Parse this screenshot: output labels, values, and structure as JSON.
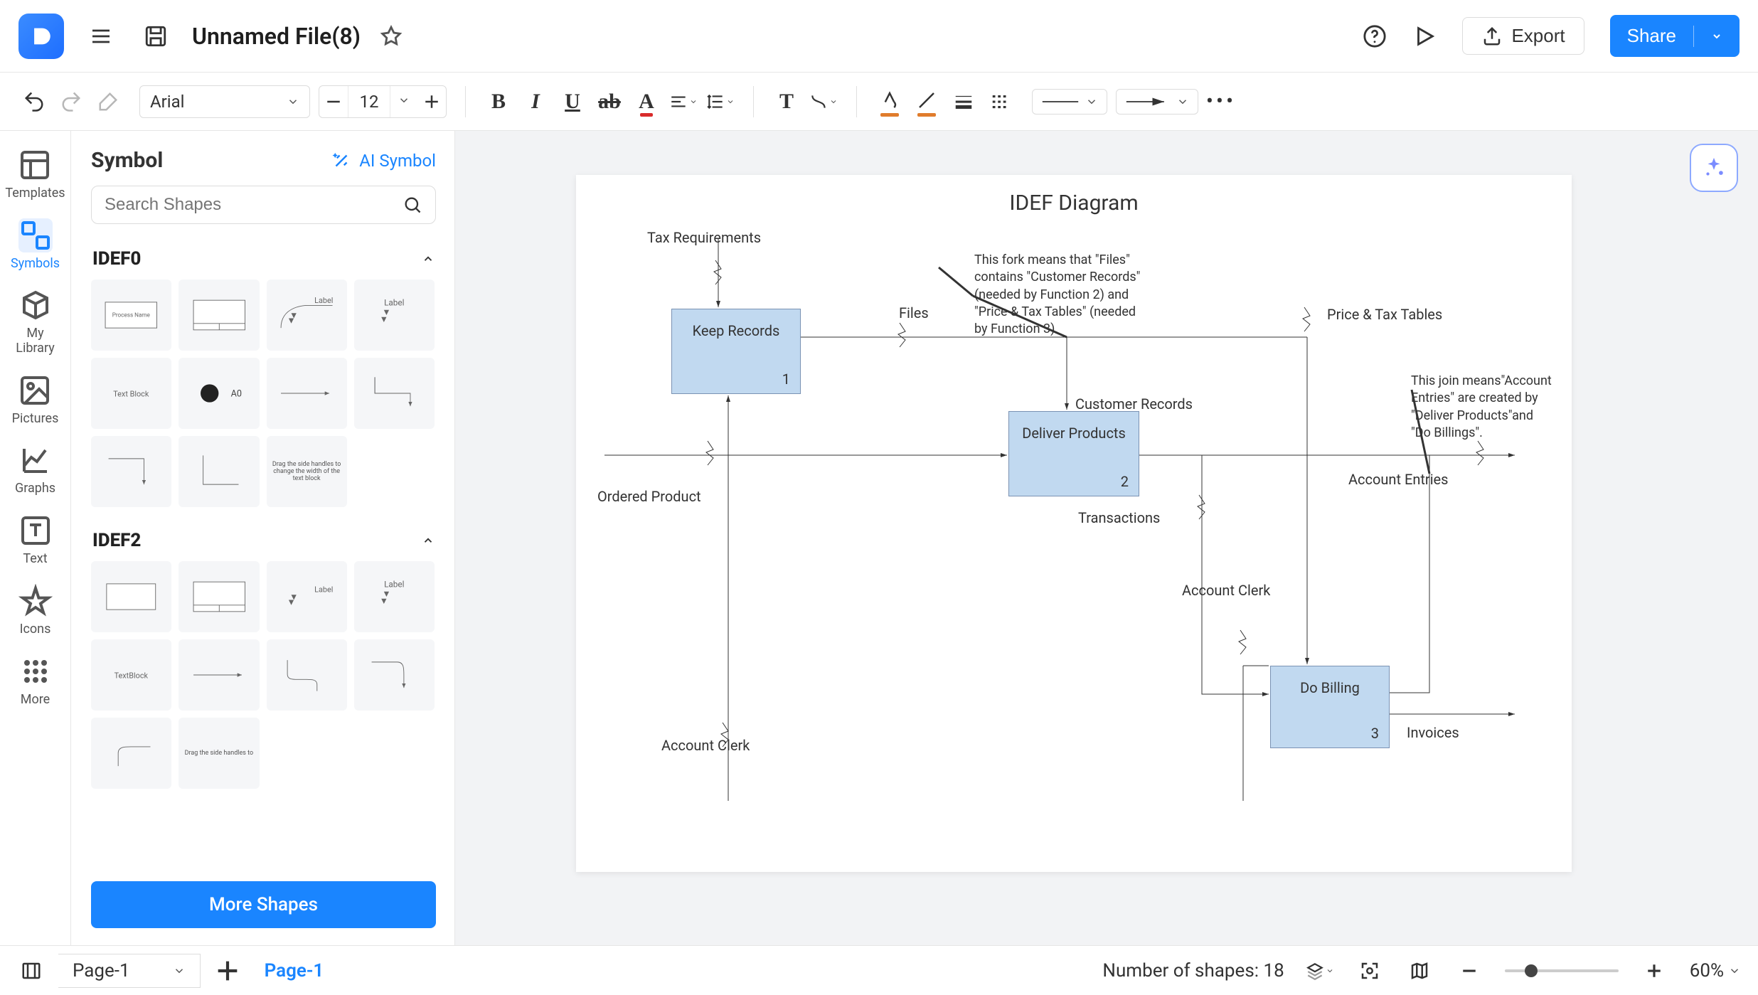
{
  "header": {
    "file_title": "Unnamed File(8)",
    "export_label": "Export",
    "share_label": "Share"
  },
  "toolbar": {
    "font_family": "Arial",
    "font_size": "12"
  },
  "left_rail": {
    "items": [
      {
        "label": "Templates"
      },
      {
        "label": "Symbols"
      },
      {
        "label": "My\nLibrary"
      },
      {
        "label": "Pictures"
      },
      {
        "label": "Graphs"
      },
      {
        "label": "Text"
      },
      {
        "label": "Icons"
      },
      {
        "label": "More"
      }
    ]
  },
  "symbol_panel": {
    "title": "Symbol",
    "ai_label": "AI Symbol",
    "search_placeholder": "Search Shapes",
    "more_shapes": "More Shapes",
    "categories": [
      {
        "name": "IDEF0"
      },
      {
        "name": "IDEF2"
      }
    ],
    "tiles": {
      "process_name": "Process Name",
      "label": "Label",
      "text_block": "Text Block",
      "a0": "A0",
      "drag_note": "Drag the side handles to change the width of the text block",
      "text_block2": "TextBlock",
      "drag_note2": "Drag the side handles to"
    }
  },
  "diagram": {
    "title": "IDEF Diagram",
    "nodes": [
      {
        "label": "Keep Records",
        "idx": "1"
      },
      {
        "label": "Deliver Products",
        "idx": "2"
      },
      {
        "label": "Do Billing",
        "idx": "3"
      }
    ],
    "labels": {
      "tax_requirements": "Tax Requirements",
      "files": "Files",
      "price_tax_tables": "Price & Tax Tables",
      "customer_records": "Customer Records",
      "ordered_product": "Ordered Product",
      "transactions": "Transactions",
      "account_clerk1": "Account Clerk",
      "account_clerk2": "Account Clerk",
      "account_entries": "Account Entries",
      "invoices": "Invoices"
    },
    "annotations": {
      "fork": "This fork means that \"Files\" contains \"Customer Records\" (needed by Function 2) and \"Price & Tax Tables\" (needed by Function 3).",
      "join": "This join means\"Account Entries\" are created by \"Deliver Products\"and \"Do Billings\"."
    }
  },
  "statusbar": {
    "page_selected": "Page-1",
    "page_tab": "Page-1",
    "shape_count_text": "Number of shapes: 18",
    "zoom_text": "60%"
  },
  "icons": {
    "chevron_down": "▾",
    "ellipsis": "•••"
  },
  "colors": {
    "accent": "#1a85ff",
    "node_fill": "#c1d9f0",
    "node_stroke": "#7a92b3"
  },
  "chart_data": {
    "type": "diagram",
    "family": "IDEF0",
    "title": "IDEF Diagram",
    "nodes": [
      {
        "id": 1,
        "name": "Keep Records"
      },
      {
        "id": 2,
        "name": "Deliver Products"
      },
      {
        "id": 3,
        "name": "Do Billing"
      }
    ],
    "controls": [
      {
        "name": "Tax Requirements",
        "to": 1
      },
      {
        "name": "Customer Records",
        "to": 2,
        "via_fork_of": "Files"
      },
      {
        "name": "Price & Tax Tables",
        "to": 3,
        "via_fork_of": "Files"
      }
    ],
    "inputs": [
      {
        "name": "Ordered Product",
        "to": 2
      },
      {
        "name": "Transactions",
        "to": 3,
        "from": 2
      }
    ],
    "outputs": [
      {
        "name": "Files",
        "from": 1,
        "fork_to": [
          "Customer Records",
          "Price & Tax Tables"
        ]
      },
      {
        "name": "Account Entries",
        "from_join_of": [
          2,
          3
        ]
      },
      {
        "name": "Invoices",
        "from": 3
      }
    ],
    "mechanisms": [
      {
        "name": "Account Clerk",
        "to": 1
      },
      {
        "name": "Account Clerk",
        "to": 3
      }
    ],
    "notes": [
      "This fork means that \"Files\" contains \"Customer Records\" (needed by Function 2) and \"Price & Tax Tables\" (needed by Function 3).",
      "This join means \"Account Entries\" are created by \"Deliver Products\" and \"Do Billings\"."
    ]
  }
}
